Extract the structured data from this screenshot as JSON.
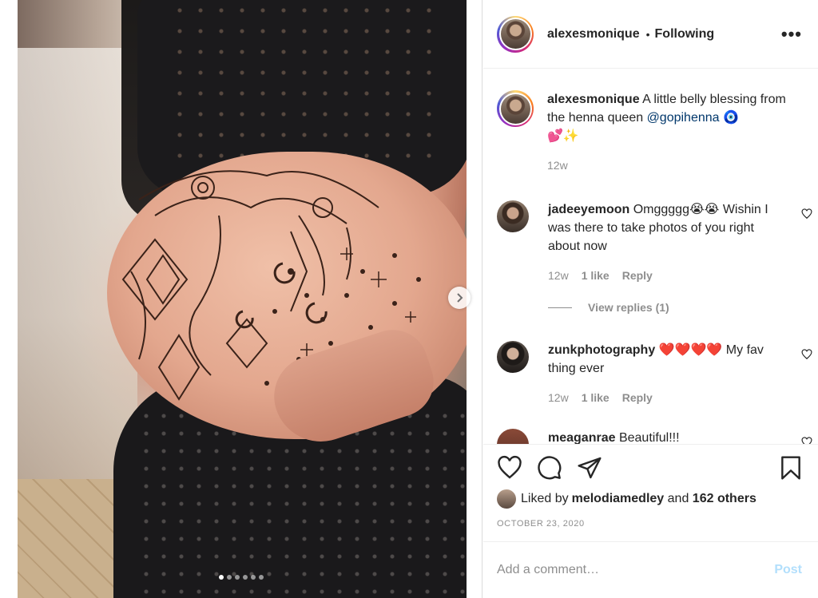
{
  "post": {
    "carousel": {
      "total": 6,
      "active": 0
    }
  },
  "header": {
    "username": "alexesmonique",
    "separator": "•",
    "follow_status": "Following",
    "more": "•••"
  },
  "caption": {
    "username": "alexesmonique",
    "text_before": " A little belly blessing from the henna queen ",
    "mention": "@gopihenna",
    "emoji_after_mention": " 🧿",
    "emoji_line": "💕✨",
    "time": "12w"
  },
  "comments": [
    {
      "username": "jadeeyemoon",
      "text": " Omggggg😭😭 Wishin I was there to take photos of you right about now",
      "time": "12w",
      "likes": "1 like",
      "reply": "Reply",
      "view_replies": "View replies (1)"
    },
    {
      "username": "zunkphotography",
      "text": " ❤️❤️❤️❤️ My fav thing ever",
      "time": "12w",
      "likes": "1 like",
      "reply": "Reply"
    },
    {
      "username": "meaganrae",
      "text": " Beautiful!!!"
    }
  ],
  "likes": {
    "prefix": "Liked by ",
    "user": "melodiamedley",
    "middle": " and ",
    "others": "162 others"
  },
  "date": "OCTOBER 23, 2020",
  "add_comment": {
    "placeholder": "Add a comment…",
    "post_label": "Post"
  },
  "colors": {
    "text": "#262626",
    "secondary": "#8e8e8e",
    "mention": "#00376b",
    "post_disabled": "#b2dffc",
    "border": "#dbdbdb"
  },
  "icons": [
    "chevron-right-icon",
    "more-icon",
    "heart-icon",
    "comment-icon",
    "share-icon",
    "bookmark-icon"
  ]
}
